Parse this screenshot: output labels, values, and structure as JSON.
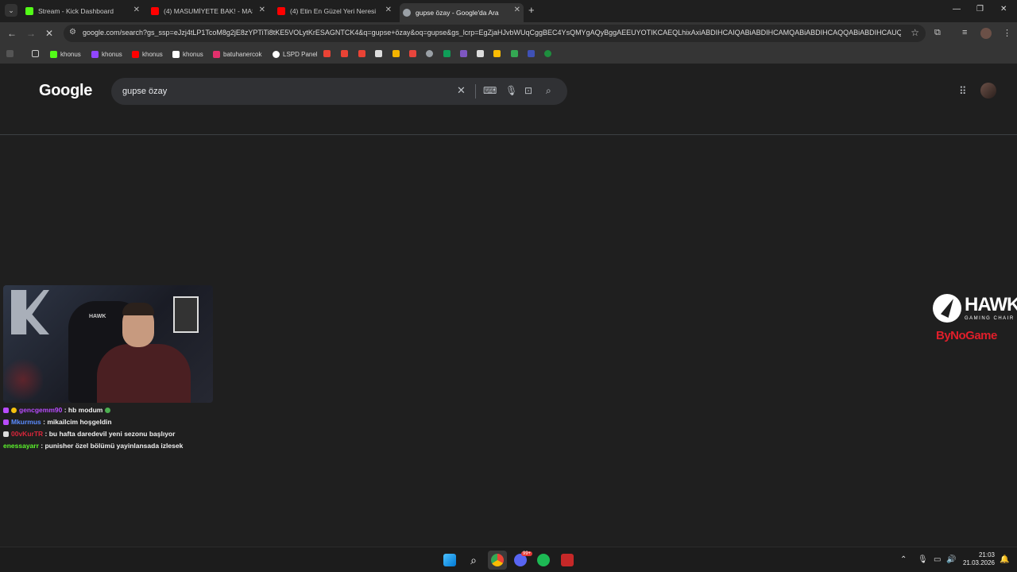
{
  "tabs": [
    {
      "title": "Stream - Kick Dashboard",
      "favicon_color": "#53fc18",
      "active": false
    },
    {
      "title": "(4) MASUMİYETE BAK! - MASUMİYET",
      "favicon_color": "#ff0000",
      "active": false
    },
    {
      "title": "(4) Etin En Güzel Yeri Neresi | Et",
      "favicon_color": "#ff0000",
      "active": false
    },
    {
      "title": "gupse özay - Google'da Ara",
      "favicon_color": "#9aa0a6",
      "active": true
    }
  ],
  "omnibox": {
    "url": "google.com/search?gs_ssp=eJzj4tLP1TcoM8g2jE8zYPTiTi8tKE5VOLytKrESAGNTCK4&q=gupse+özay&oq=gupse&gs_lcrp=EgZjaHJvbWUqCggBEC4YsQMYgAQyBggAEEUYOTIKCAEQLhixAxiABDIHCAIQABiABDIHCAMQABiABDIHCAQQABiABDIHCAUQA..."
  },
  "bookmarks": [
    {
      "label": "khonus",
      "color": "#53fc18"
    },
    {
      "label": "khonus",
      "color": "#9146ff"
    },
    {
      "label": "khonus",
      "color": "#ff0000"
    },
    {
      "label": "khonus",
      "color": "#ffffff"
    },
    {
      "label": "batuhanercok",
      "color": "#e1306c"
    },
    {
      "label": "LSPD Panel",
      "color": "#ffffff"
    }
  ],
  "google": {
    "logo": "Google",
    "query": "gupse özay"
  },
  "chat": [
    {
      "user": "gencgemm90",
      "color": "#b94cff",
      "message": ": hb modum"
    },
    {
      "user": "Mkurmus",
      "color": "#5b8cff",
      "message": ": mikailcim hoşgeldin"
    },
    {
      "user": "00vKurTR",
      "color": "#d9263b",
      "message": ": bu hafta daredevil yeni sezonu başlıyor"
    },
    {
      "user": "enessayarr",
      "color": "#5cf52c",
      "message": ": punisher özel bölümü yayinlansada izlesek"
    }
  ],
  "sponsor": {
    "brand": "HAWK",
    "subline": "GAMING CHAIR",
    "partner": "ByNoGame"
  },
  "webcam": {
    "chair_logo": "HAWK"
  },
  "taskbar": {
    "time": "21:03",
    "date": "21.03.2026",
    "discord_badge": "99+"
  }
}
